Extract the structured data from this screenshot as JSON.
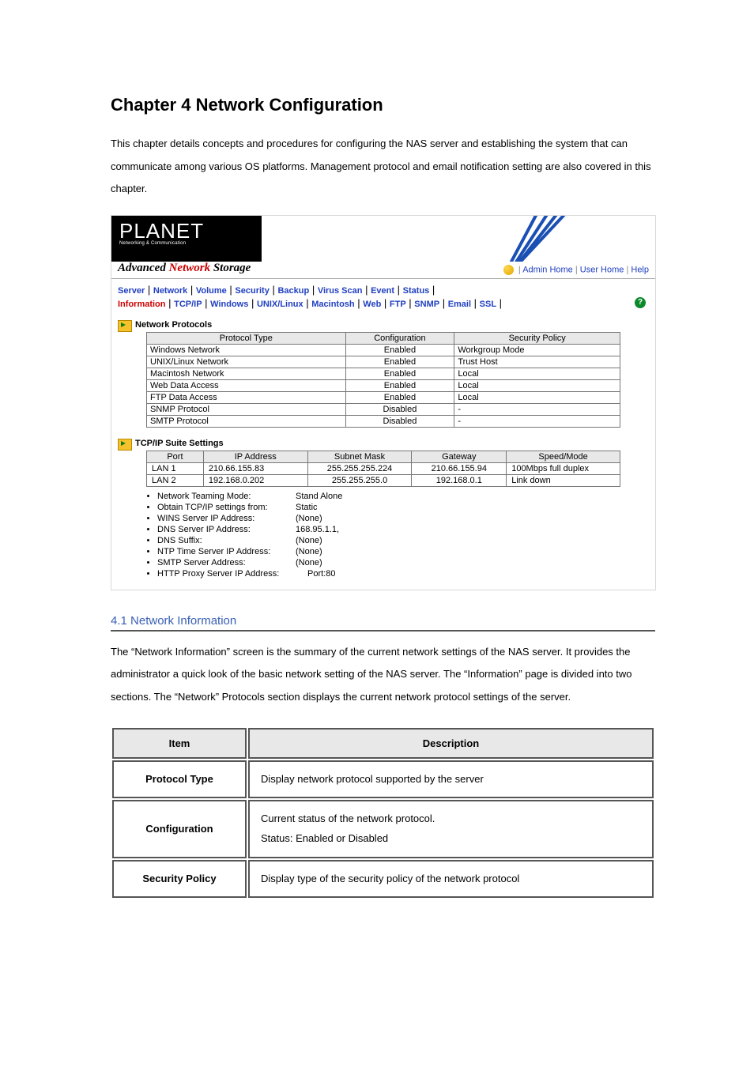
{
  "chapter_title": "Chapter 4 Network Configuration",
  "intro_text": "This chapter details concepts and procedures for configuring the NAS server and establishing the system that can communicate among various OS platforms. Management protocol and email notification setting are also covered in this chapter.",
  "app": {
    "logo_text": "PLANET",
    "logo_tag": "Networking & Communication",
    "product_title_plain": "Advanced ",
    "product_title_highlight": "Network",
    "product_title_tail": " Storage",
    "top_links": {
      "admin": "Admin Home",
      "user": "User Home",
      "help": "Help"
    },
    "main_tabs": [
      "Server",
      "Network",
      "Volume",
      "Security",
      "Backup",
      "Virus Scan",
      "Event",
      "Status"
    ],
    "sec_tabs": [
      "Information",
      "TCP/IP",
      "Windows",
      "UNIX/Linux",
      "Macintosh",
      "Web",
      "FTP",
      "SNMP",
      "Email",
      "SSL"
    ],
    "sec_active": "Information",
    "section1_title": "Network Protocols",
    "protocols_headers": [
      "Protocol Type",
      "Configuration",
      "Security Policy"
    ],
    "protocols": [
      {
        "type": "Windows Network",
        "config": "Enabled",
        "policy": "Workgroup Mode"
      },
      {
        "type": "UNIX/Linux Network",
        "config": "Enabled",
        "policy": "Trust Host"
      },
      {
        "type": "Macintosh Network",
        "config": "Enabled",
        "policy": "Local"
      },
      {
        "type": "Web Data Access",
        "config": "Enabled",
        "policy": "Local"
      },
      {
        "type": "FTP Data Access",
        "config": "Enabled",
        "policy": "Local"
      },
      {
        "type": "SNMP Protocol",
        "config": "Disabled",
        "policy": "-"
      },
      {
        "type": "SMTP Protocol",
        "config": "Disabled",
        "policy": "-"
      }
    ],
    "section2_title": "TCP/IP Suite Settings",
    "tcpip_headers": [
      "Port",
      "IP Address",
      "Subnet Mask",
      "Gateway",
      "Speed/Mode"
    ],
    "tcpip": [
      {
        "port": "LAN 1",
        "ip": "210.66.155.83",
        "mask": "255.255.255.224",
        "gw": "210.66.155.94",
        "speed": "100Mbps full duplex"
      },
      {
        "port": "LAN 2",
        "ip": "192.168.0.202",
        "mask": "255.255.255.0",
        "gw": "192.168.0.1",
        "speed": "Link down"
      }
    ],
    "settings": [
      {
        "k": "Network Teaming Mode:",
        "v": "Stand Alone"
      },
      {
        "k": "Obtain TCP/IP settings from:",
        "v": "Static"
      },
      {
        "k": "WINS Server IP Address:",
        "v": "(None)"
      },
      {
        "k": "DNS Server IP Address:",
        "v": "168.95.1.1,"
      },
      {
        "k": "DNS Suffix:",
        "v": "(None)"
      },
      {
        "k": "NTP Time Server IP Address:",
        "v": "(None)"
      },
      {
        "k": "SMTP Server Address:",
        "v": "(None)"
      },
      {
        "k": "HTTP Proxy Server IP Address:",
        "v": "Port:80"
      }
    ]
  },
  "sub_heading": "4.1 Network Information",
  "sub_desc": "The “Network Information” screen is the summary of the current network settings of the NAS server. It provides the administrator a quick look of the basic network setting of the NAS server. The “Information” page is divided into two sections. The “Network” Protocols section displays the current network protocol settings of the server.",
  "spec_headers": {
    "item": "Item",
    "desc": "Description"
  },
  "spec_rows": [
    {
      "item": "Protocol Type",
      "desc": "Display network protocol supported by the server"
    },
    {
      "item": "Configuration",
      "desc": "Current status of the network protocol.\nStatus: Enabled or Disabled"
    },
    {
      "item": "Security Policy",
      "desc": "Display type of the security policy of the network protocol"
    }
  ]
}
